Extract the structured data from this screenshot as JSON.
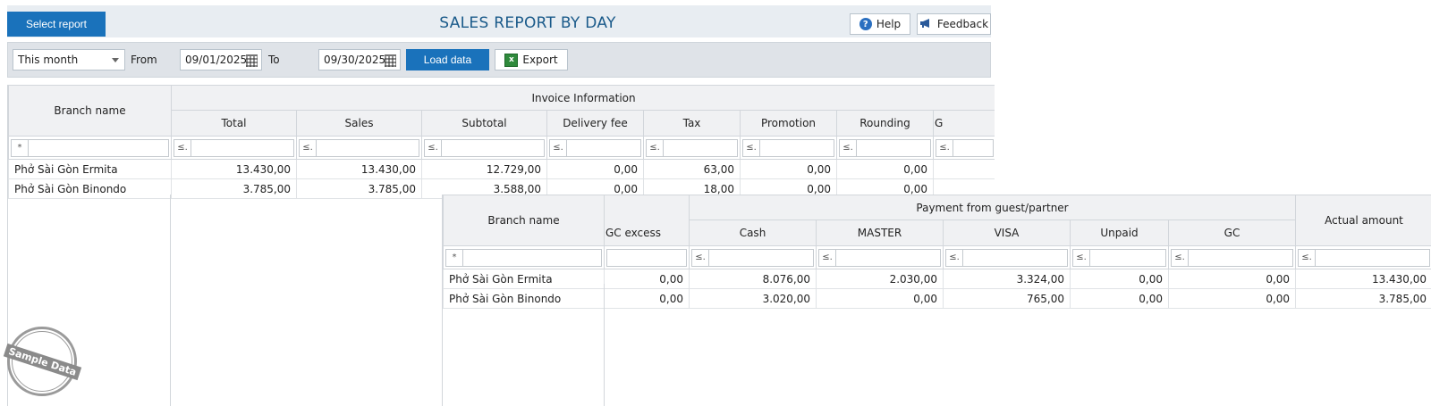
{
  "toolbar": {
    "select_report": "Select report",
    "title": "SALES REPORT BY DAY",
    "help": "Help",
    "feedback": "Feedback"
  },
  "filters": {
    "period": "This month",
    "from_label": "From",
    "from_date": "09/01/2025",
    "to_label": "To",
    "to_date": "09/30/2025",
    "load": "Load data",
    "export": "Export"
  },
  "invoice_table": {
    "branch_header": "Branch name",
    "group_header": "Invoice Information",
    "columns": [
      "Total",
      "Sales",
      "Subtotal",
      "Delivery fee",
      "Tax",
      "Promotion",
      "Rounding",
      "G"
    ],
    "rows": [
      {
        "name": "Phở Sài Gòn Ermita",
        "values": [
          "13.430,00",
          "13.430,00",
          "12.729,00",
          "0,00",
          "63,00",
          "0,00",
          "0,00",
          ""
        ]
      },
      {
        "name": "Phở Sài Gòn Binondo",
        "values": [
          "3.785,00",
          "3.785,00",
          "3.588,00",
          "0,00",
          "18,00",
          "0,00",
          "0,00",
          ""
        ]
      }
    ]
  },
  "payment_table": {
    "branch_header": "Branch name",
    "gc_excess_header": "GC excess",
    "group_header": "Payment from guest/partner",
    "columns": [
      "Cash",
      "MASTER",
      "VISA",
      "Unpaid",
      "GC"
    ],
    "actual_header": "Actual amount",
    "rows": [
      {
        "name": "Phở Sài Gòn Ermita",
        "gc_excess": "0,00",
        "values": [
          "8.076,00",
          "2.030,00",
          "3.324,00",
          "0,00",
          "0,00"
        ],
        "actual": "13.430,00"
      },
      {
        "name": "Phở Sài Gòn Binondo",
        "gc_excess": "0,00",
        "values": [
          "3.020,00",
          "0,00",
          "765,00",
          "0,00",
          "0,00"
        ],
        "actual": "3.785,00"
      }
    ]
  },
  "filter_ops": {
    "name": "*",
    "num": "≤."
  },
  "stamp": {
    "text": "Sample Data"
  },
  "colors": {
    "primary": "#1a72bb",
    "title": "#1a5a8a"
  }
}
